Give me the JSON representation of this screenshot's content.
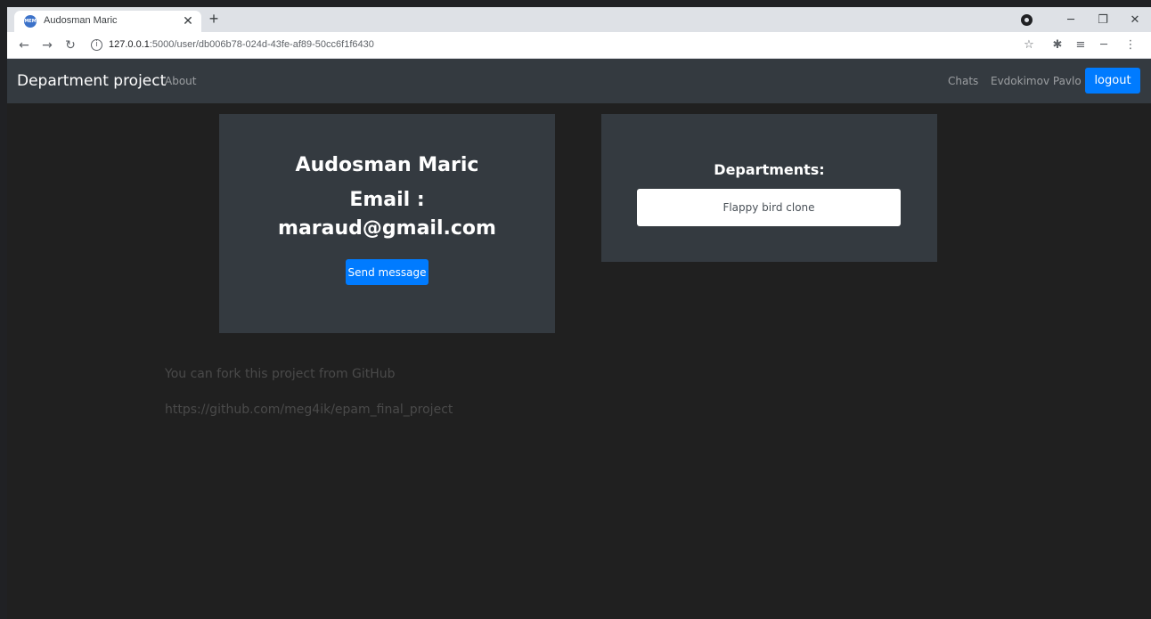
{
  "browser": {
    "tab_title": "Audosman Maric",
    "favicon_text": "MEM",
    "url_host": "127.0.0.1",
    "url_path": ":5000/user/db006b78-024d-43fe-af89-50cc6f1f6430"
  },
  "navbar": {
    "brand": "Department project",
    "about": "About",
    "chats": "Chats",
    "user": "Evdokimov Pavlo",
    "logout": "logout"
  },
  "user_card": {
    "name": "Audosman Maric",
    "email_label": "Email :",
    "email": "maraud@gmail.com",
    "send_button": "Send message"
  },
  "departments_card": {
    "title": "Departments:",
    "items": [
      "Flappy bird clone"
    ]
  },
  "footer": {
    "line1": "You can fork this project from GitHub",
    "line2": "https://github.com/meg4ik/epam_final_project"
  }
}
